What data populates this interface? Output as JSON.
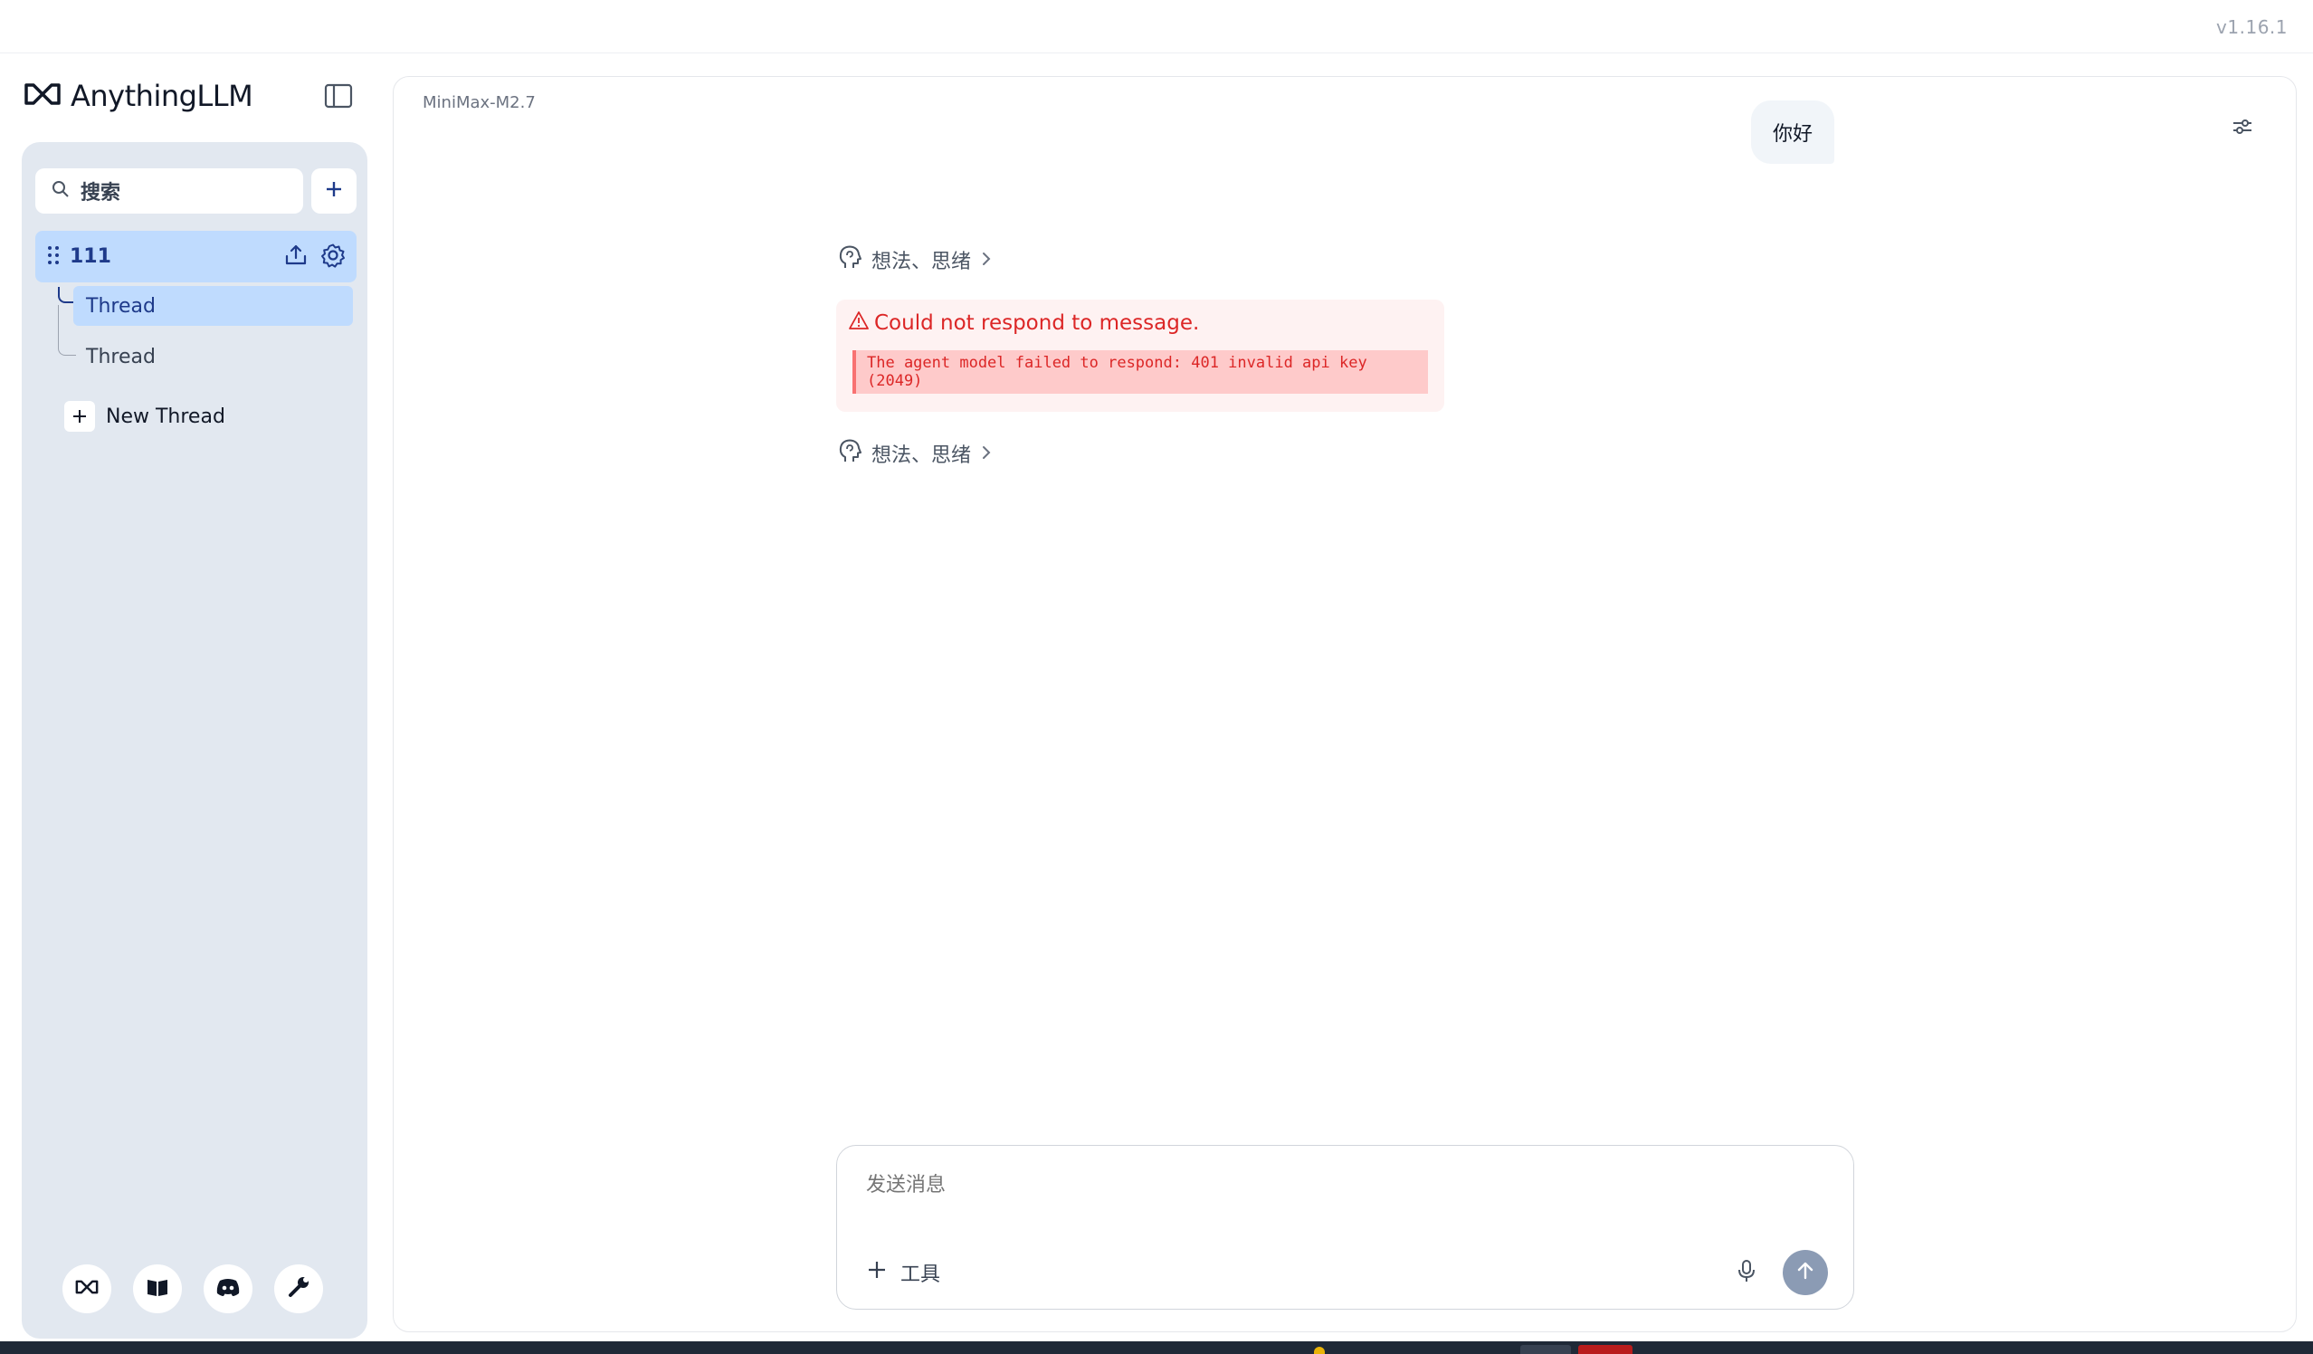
{
  "app": {
    "version": "v1.16.1",
    "brand_name": "AnythingLLM"
  },
  "sidebar": {
    "search_placeholder": "搜索",
    "workspace": {
      "name": "111",
      "threads": [
        {
          "label": "Thread",
          "active": true
        },
        {
          "label": "Thread",
          "active": false
        }
      ],
      "new_thread_label": "New Thread"
    },
    "footer_icons": [
      "anythingllm-logo-icon",
      "book-icon",
      "discord-icon",
      "wrench-icon"
    ]
  },
  "chat": {
    "model_label": "MiniMax-M2.7",
    "user_message": "你好",
    "thought_label": "想法、思绪",
    "error": {
      "title": "Could not respond to message.",
      "detail": "The agent model failed to respond: 401 invalid api key (2049)"
    },
    "composer": {
      "placeholder": "发送消息",
      "tools_label": "工具"
    }
  },
  "colors": {
    "accent": "#1e3a8a",
    "active_bg": "#bfdbfe",
    "sidebar_bg": "#e2e8f0",
    "error": "#dc2626",
    "send_button": "#8b9bb4"
  }
}
